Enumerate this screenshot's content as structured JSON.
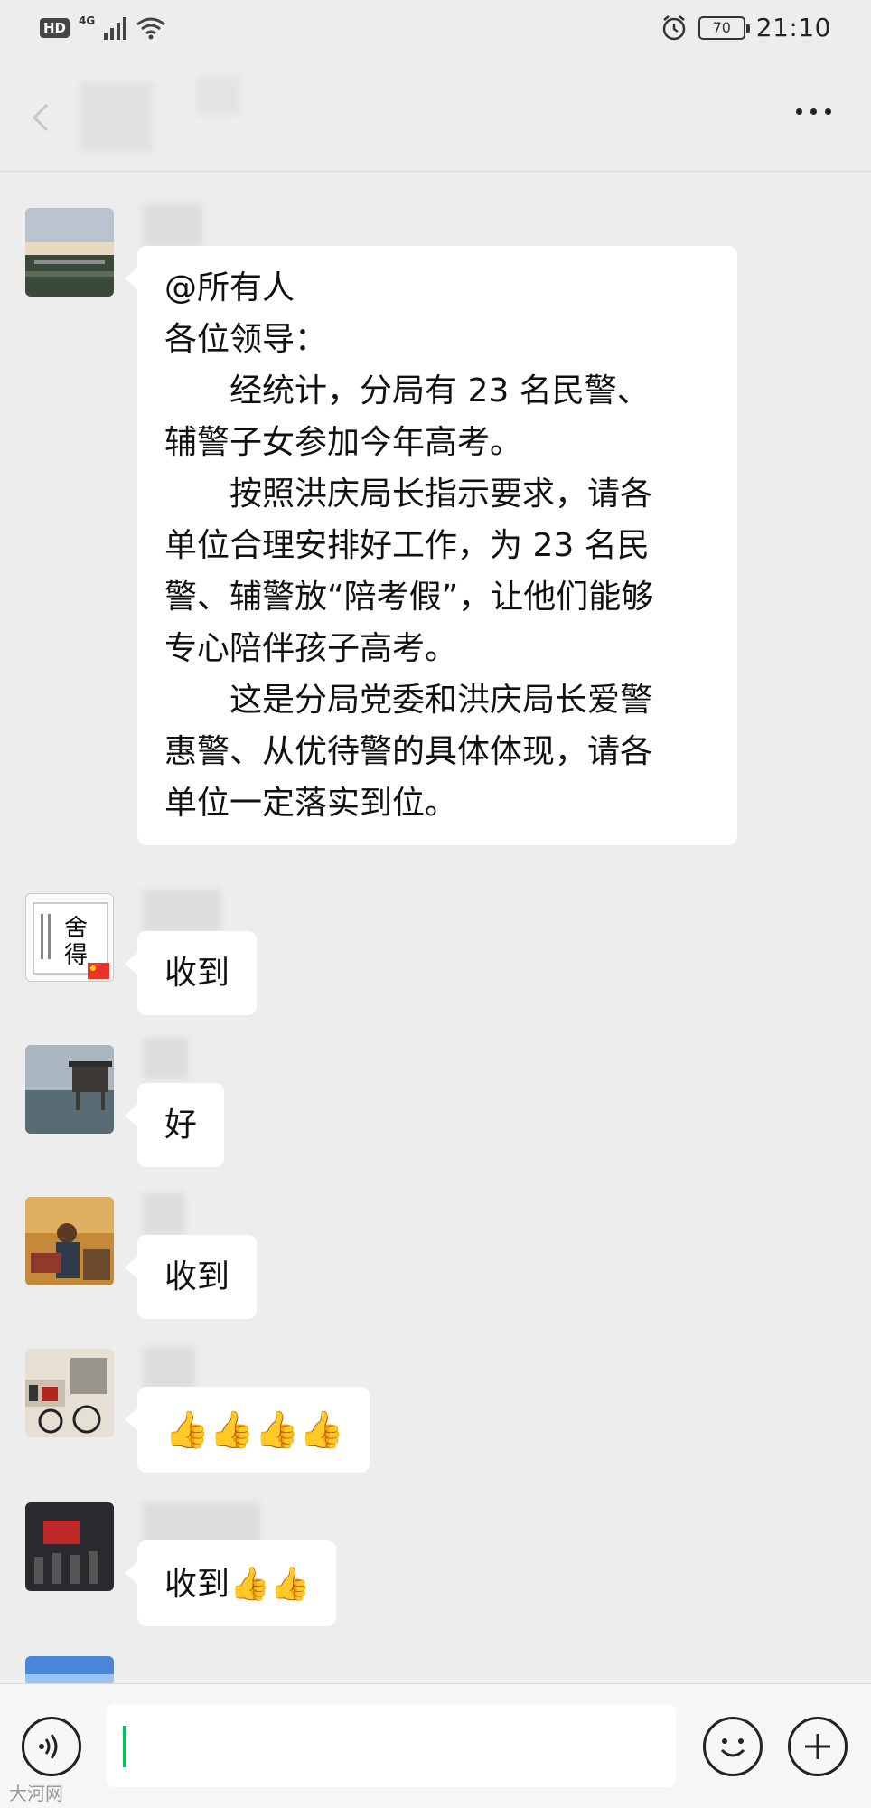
{
  "status_bar": {
    "hd": "HD",
    "network": "4G",
    "battery": "70",
    "time": "21:10"
  },
  "messages": [
    {
      "lines": [
        "@所有人",
        "各位领导：",
        "经统计，分局有 23 名民警、",
        "辅警子女参加今年高考。",
        "按照洪庆局长指示要求，请各",
        "单位合理安排好工作，为 23 名民",
        "警、辅警放“陪考假”，让他们能够",
        "专心陪伴孩子高考。",
        "这是分局党委和洪庆局长爱警",
        "惠警、从优待警的具体体现，请各",
        "单位一定落实到位。"
      ]
    },
    {
      "text": "收到"
    },
    {
      "text": "好"
    },
    {
      "text": "收到"
    },
    {
      "text": "👍👍👍👍"
    },
    {
      "text": "收到👍👍"
    }
  ],
  "avatar_texts": {
    "calligraphy": "舍得"
  },
  "watermark": "大河网"
}
